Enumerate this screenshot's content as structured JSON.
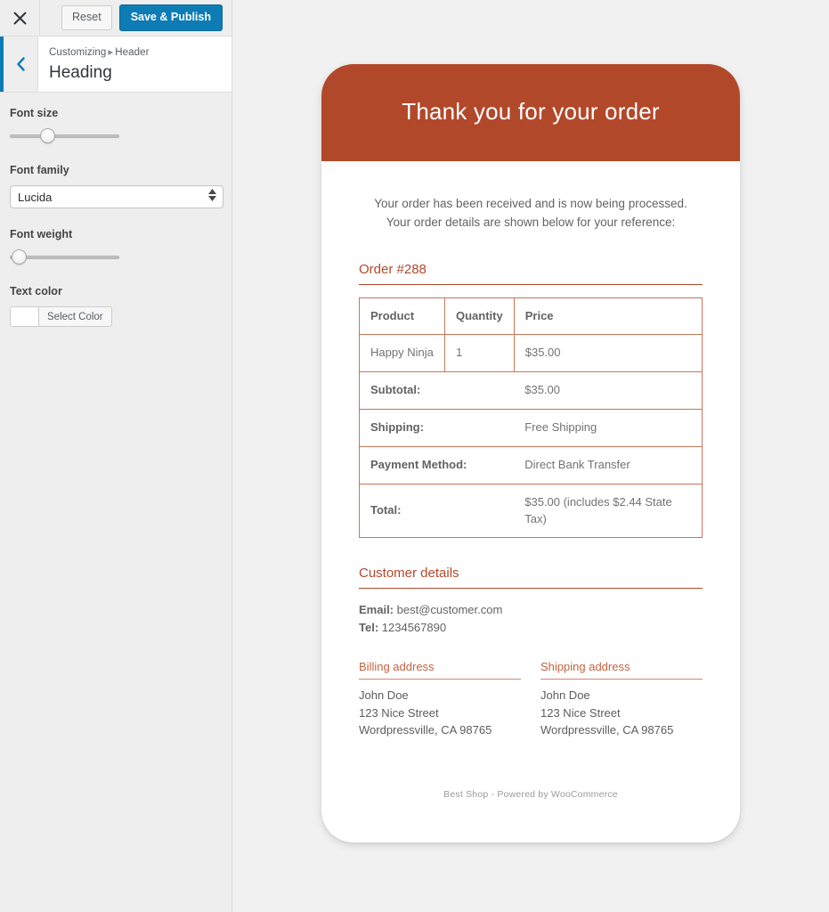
{
  "customizer": {
    "topbar": {
      "close_icon": "close-icon",
      "reset_label": "Reset",
      "save_label": "Save & Publish",
      "accent_color": "#0d7cb5"
    },
    "header": {
      "back_icon": "chevron-left-icon",
      "breadcrumb_root": "Customizing",
      "breadcrumb_separator": "▸",
      "breadcrumb_current": "Header",
      "panel_title": "Heading"
    },
    "controls": [
      {
        "type": "slider",
        "label": "Font size",
        "name": "font-size-slider",
        "thumb_percent": 32
      },
      {
        "type": "select",
        "label": "Font family",
        "name": "font-family-select",
        "value": "Lucida"
      },
      {
        "type": "slider",
        "label": "Font weight",
        "name": "font-weight-slider",
        "thumb_percent": 2
      },
      {
        "type": "color",
        "label": "Text color",
        "name": "text-color-picker",
        "swatch_color": "#ffffff",
        "button_label": "Select Color"
      }
    ]
  },
  "email": {
    "accent_color": "#b2482a",
    "header_title": "Thank you for your order",
    "intro_line1": "Your order has been received and is now being processed.",
    "intro_line2": "Your order details are shown below for your reference:",
    "order_title": "Order #288",
    "table": {
      "columns": [
        "Product",
        "Quantity",
        "Price"
      ],
      "items": [
        {
          "product": "Happy Ninja",
          "quantity": "1",
          "price": "$35.00"
        }
      ],
      "totals": [
        {
          "label": "Subtotal:",
          "value": "$35.00"
        },
        {
          "label": "Shipping:",
          "value": "Free Shipping"
        },
        {
          "label": "Payment Method:",
          "value": "Direct Bank Transfer"
        },
        {
          "label": "Total:",
          "value": "$35.00 (includes $2.44 State Tax)"
        }
      ]
    },
    "customer_title": "Customer details",
    "email_label": "Email:",
    "email_value": "best@customer.com",
    "tel_label": "Tel:",
    "tel_value": "1234567890",
    "billing": {
      "title": "Billing address",
      "body": "John Doe\n123 Nice Street\nWordpressville, CA 98765"
    },
    "shipping": {
      "title": "Shipping address",
      "body": "John Doe\n123 Nice Street\nWordpressville, CA 98765"
    },
    "footer": "Best Shop - Powered by WooCommerce"
  }
}
